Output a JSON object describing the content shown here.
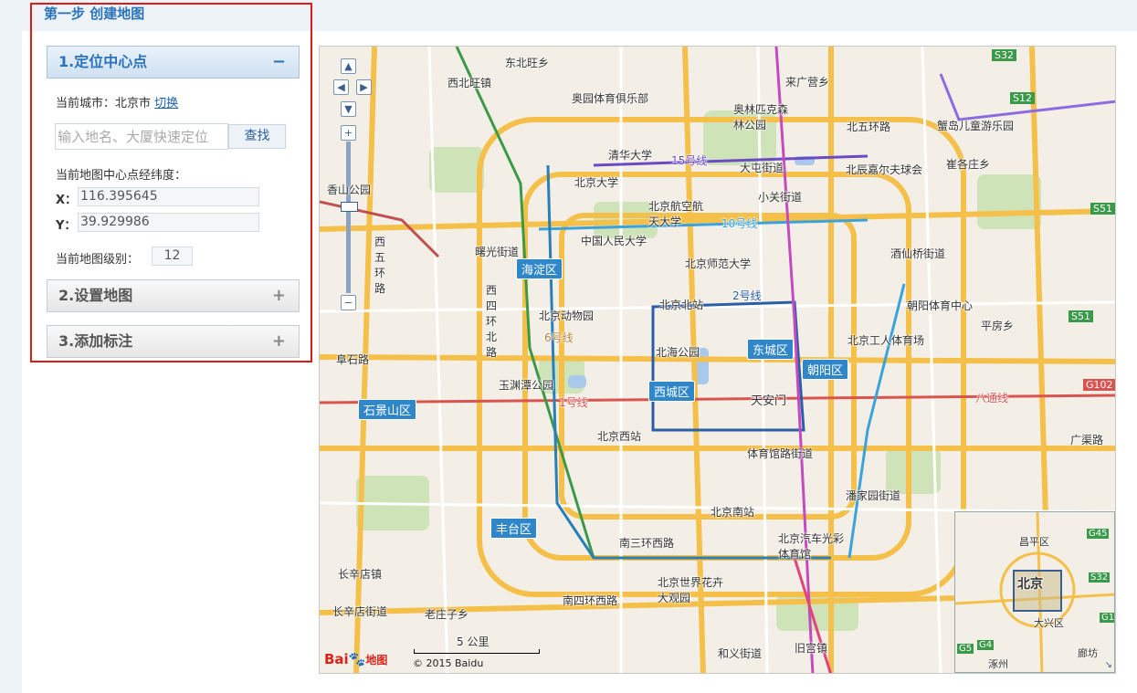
{
  "step_title": "第一步 创建地图",
  "panels": [
    {
      "title": "1.定位中心点",
      "toggle": "−"
    },
    {
      "title": "2.设置地图",
      "toggle": "+"
    },
    {
      "title": "3.添加标注",
      "toggle": "+"
    }
  ],
  "locate": {
    "current_city_label": "当前城市：",
    "current_city": "北京市",
    "switch_link": "切换",
    "search_placeholder": "输入地名、大厦快速定位",
    "search_button": "查找",
    "center_label": "当前地图中心点经纬度：",
    "x_label": "X：",
    "x_value": "116.395645",
    "y_label": "Y：",
    "y_value": "39.929986",
    "level_label": "当前地图级别：",
    "level_value": "12"
  },
  "map": {
    "districts": [
      "海淀区",
      "东城区",
      "朝阳区",
      "西城区",
      "石景山区",
      "丰台区"
    ],
    "labels": {
      "l1": "东北旺乡",
      "l2": "西北旺镇",
      "l3": "来广营乡",
      "l4": "奥园体育俱乐部",
      "l5": "奥林匹克森林公园",
      "l6": "北五环路",
      "l7": "蟹岛儿童游乐园",
      "l8": "清华大学",
      "l9": "15号线",
      "l10": "大屯街道",
      "l11": "北辰嘉尔夫球会",
      "l12": "崔各庄乡",
      "l13": "北京大学",
      "l14": "北京航空航天大学",
      "l15": "小关街道",
      "l16": "10号线",
      "l17": "中国人民大学",
      "l18": "曙光街道",
      "l19": "北京师范大学",
      "l20": "酒仙桥街道",
      "l21": "北京北站",
      "l22": "2号线",
      "l23": "朝阳体育中心",
      "l24": "北京动物园",
      "l25": "6号线",
      "l26": "平房乡",
      "l27": "北海公园",
      "l28": "北京工人体育场",
      "l29": "阜石路",
      "l30": "玉渊潭公园",
      "l31": "天安门",
      "l32": "1号线",
      "l33": "八通线",
      "l34": "北京西站",
      "l35": "广渠路",
      "l36": "体育馆路街道",
      "l37": "潘家园街道",
      "l38": "北京南站",
      "l39": "北京汽车光彩体育馆",
      "l40": "南三环西路",
      "l41": "长辛店镇",
      "l42": "北京世界花卉大观园",
      "l43": "南四环西路",
      "l44": "长辛店街道",
      "l45": "老庄子乡",
      "l46": "和义街道",
      "l47": "旧宫镇",
      "l48": "西五环路",
      "l49": "西四环北路",
      "l50": "香山公园"
    },
    "scale_text": "5 公里",
    "copyright": "© 2015 Baidu",
    "logo_text": "Bai",
    "logo_text2": "地图",
    "overview_labels": {
      "o1": "昌平区",
      "o2": "北京",
      "o3": "大兴区",
      "o4": "涿州",
      "o5": "廊坊"
    },
    "shields": {
      "s1": "S32",
      "s2": "S12",
      "s3": "S51",
      "s4": "S51",
      "s5": "G102",
      "s6": "G45",
      "s7": "S32",
      "s8": "G1",
      "s9": "G5",
      "s10": "G4"
    },
    "colors": {
      "accent": "#2a73b8",
      "district_bg": "#2f86c9",
      "ring_road": "#f5c04a",
      "highlight": "#e01919"
    }
  }
}
